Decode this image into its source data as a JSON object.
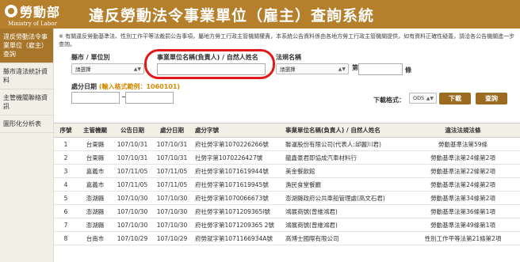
{
  "header": {
    "logo_cn": "勞動部",
    "logo_en": "Ministry of Labor",
    "title": "違反勞動法令事業單位（雇主）查詢系統"
  },
  "sidebar": {
    "items": [
      {
        "label": "違反勞動法令事業單位（雇主）查詢"
      },
      {
        "label": "縣市違法統計資料"
      },
      {
        "label": "主管機關聯絡資訊"
      },
      {
        "label": "圖形化分析表"
      }
    ]
  },
  "notice": "※ 有關違反勞動基準法、性別工作平等法裁罰公告事項，屬地方勞工行政主管機關權責，本系統公告資料係由各地方勞工行政主管機關提供，如有資料正確性疑義，請洽各公告機關進一步查詢。",
  "filters": {
    "county_label": "縣市 / 單位別",
    "county_value": "請選擇",
    "name_label": "事業單位名稱(負責人) / 自然人姓名",
    "name_value": "",
    "law_label": "法規名稱",
    "law_value": "請選擇",
    "article_label": "第",
    "article_suffix": "條",
    "date_label": "處分日期",
    "date_hint": "(輸入格式範例：1060101)",
    "date_sep": "~",
    "format_label": "下載格式：",
    "format_value": "ODS",
    "download_label": "下載",
    "search_label": "查詢"
  },
  "table": {
    "headers": [
      "序號",
      "主管機關",
      "公告日期",
      "處分日期",
      "處分字號",
      "事業單位名稱(負責人) / 自然人姓名",
      "違法法規法條"
    ],
    "rows": [
      [
        "1",
        "台東縣",
        "107/10/31",
        "107/10/31",
        "府社勞字第1070226266號",
        "聯運股份有限公司(代表人:邱麗川君)",
        "勞動基準法第59條"
      ],
      [
        "2",
        "台東縣",
        "107/10/31",
        "107/10/31",
        "社勞字第1070226427號",
        "龍鑫豪君即協成汽車材料行",
        "勞動基準法第24條第2項"
      ],
      [
        "3",
        "嘉義市",
        "107/11/05",
        "107/11/05",
        "府社勞字第1071619944號",
        "美金餐飲館",
        "勞動基準法第22條第2項"
      ],
      [
        "4",
        "嘉義市",
        "107/11/05",
        "107/11/05",
        "府社勞字第1071619945號",
        "漁民食堂餐廳",
        "勞動基準法第24條第2項"
      ],
      [
        "5",
        "澎湖縣",
        "107/10/30",
        "107/10/30",
        "府社勞字第1070066673號",
        "澎湖縣政府公共車船管理處(高文石君)",
        "勞動基準法第34條第2項"
      ],
      [
        "6",
        "澎湖縣",
        "107/10/30",
        "107/10/30",
        "府社勞字第1071209365l號",
        "鴻展商號(曾維鴻君)",
        "勞動基準法第36條第1項"
      ],
      [
        "7",
        "澎湖縣",
        "107/10/30",
        "107/10/30",
        "府社勞字第1071209365 2號",
        "鴻展商號(曾維鴻君)",
        "勞動基準法第49條第1項"
      ],
      [
        "8",
        "台南市",
        "107/10/29",
        "107/10/29",
        "府勞就字第1071166934A號",
        "高博士國際有限公司",
        "性別工作平等法第21條第2項"
      ]
    ]
  }
}
